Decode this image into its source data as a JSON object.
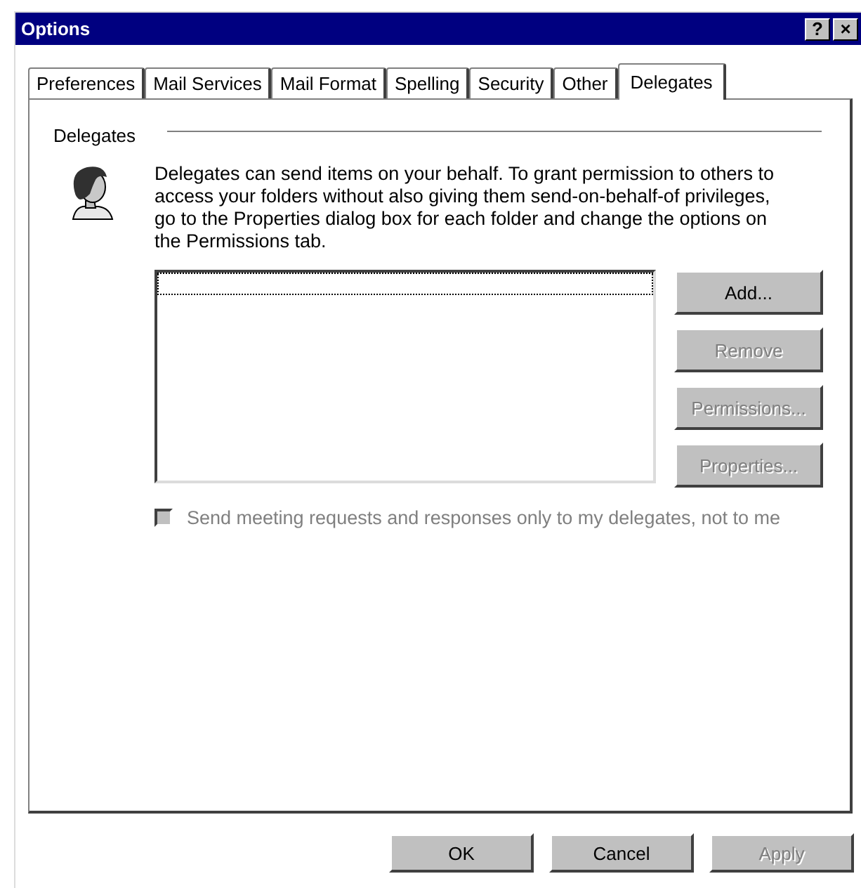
{
  "window": {
    "title": "Options",
    "title_buttons": [
      "?",
      "×"
    ]
  },
  "tabs": [
    {
      "label": "Preferences",
      "selected": false
    },
    {
      "label": "Mail Services",
      "selected": false
    },
    {
      "label": "Mail Format",
      "selected": false
    },
    {
      "label": "Spelling",
      "selected": false
    },
    {
      "label": "Security",
      "selected": false
    },
    {
      "label": "Other",
      "selected": false
    },
    {
      "label": "Delegates",
      "selected": true
    }
  ],
  "group": {
    "label": "Delegates",
    "description": "Delegates can send items on your behalf. To grant permission to others to access your folders without also giving them send-on-behalf-of privileges, go to the Properties dialog box for each folder and change the options on the Permissions tab."
  },
  "side_buttons": [
    {
      "label": "Add...",
      "disabled": false
    },
    {
      "label": "Remove",
      "disabled": true
    },
    {
      "label": "Permissions...",
      "disabled": true
    },
    {
      "label": "Properties...",
      "disabled": true
    }
  ],
  "option": {
    "label": "Send meeting requests and responses only to my delegates, not to me",
    "checked": false,
    "disabled": true
  },
  "buttons": [
    {
      "label": "OK",
      "disabled": false
    },
    {
      "label": "Cancel",
      "disabled": false
    },
    {
      "label": "Apply",
      "disabled": true
    }
  ]
}
